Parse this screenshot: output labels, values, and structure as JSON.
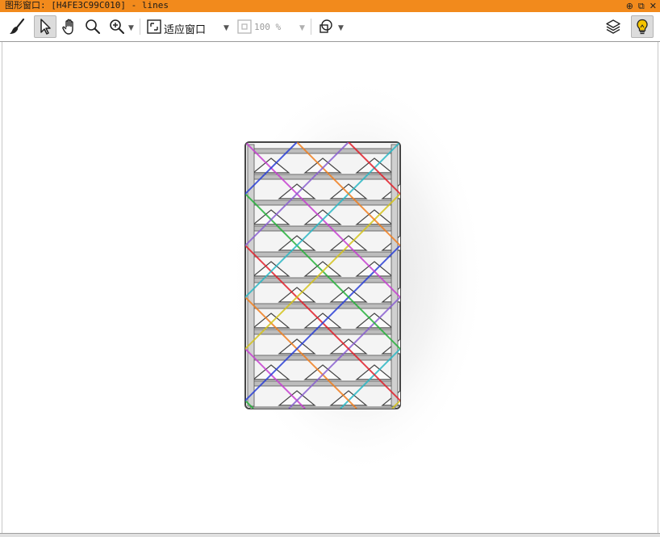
{
  "window": {
    "title": "图形窗口: [H4FE3C99C010] - lines",
    "title_bg": "#f28a1c",
    "buttons": [
      "pin-icon",
      "restore-icon",
      "close-icon"
    ],
    "button_glyphs": {
      "pin": "⊕",
      "restore": "⧉",
      "close": "✕"
    }
  },
  "toolbar": {
    "tools": [
      "clear-brush-icon",
      "select-arrow-icon",
      "pan-hand-icon",
      "magnify-icon",
      "zoom-in-icon",
      "fit-window-icon",
      "zoom-box-icon",
      "shape-icon",
      "layers-icon",
      "lightbulb-icon"
    ],
    "active_tool": "select-arrow-icon",
    "fit_label": "适应窗口",
    "zoom_value": "100 %",
    "zoom_enabled": false
  },
  "image": {
    "description_colors": {
      "line_colors": [
        "#e0202a",
        "#2a3fd6",
        "#27b23b",
        "#d4c31c",
        "#c53fd0",
        "#2ab7c4",
        "#f07f20",
        "#8a5fd0"
      ]
    }
  }
}
